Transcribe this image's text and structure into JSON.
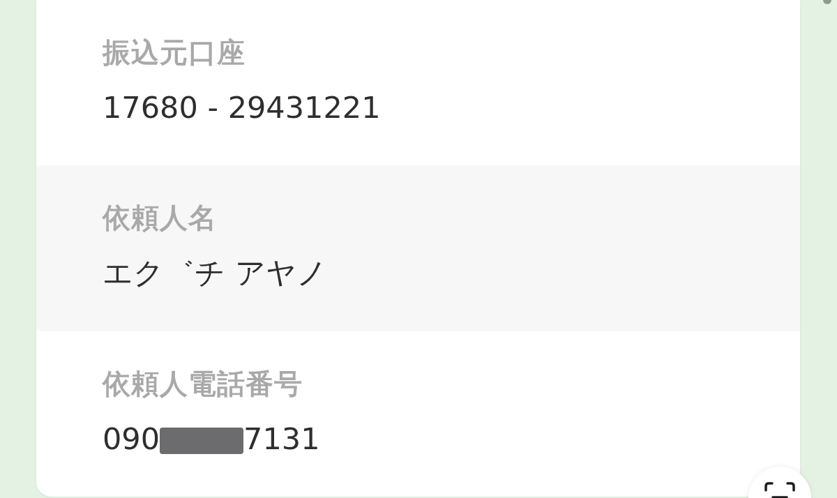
{
  "card": {
    "fields": [
      {
        "kind": "plain",
        "label": "振込元口座",
        "value": "17680 - 29431221"
      },
      {
        "kind": "plain",
        "label": "依頼人名",
        "value": "エク゛チ アヤノ"
      },
      {
        "kind": "redacted",
        "label": "依頼人電話番号",
        "value_parts": [
          "090",
          "7131"
        ]
      }
    ]
  }
}
